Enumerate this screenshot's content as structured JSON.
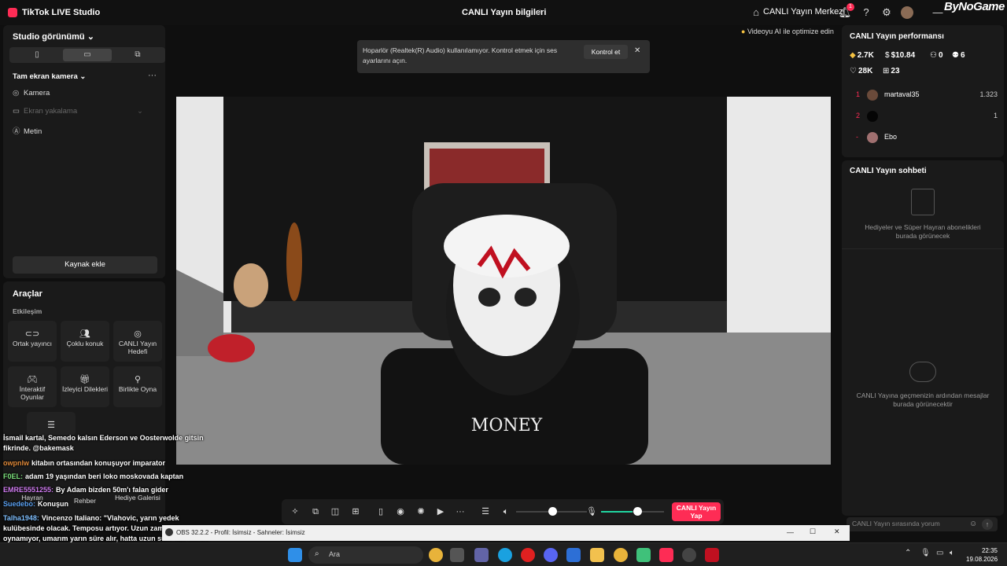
{
  "titlebar": {
    "app_title": "TikTok LIVE Studio",
    "center_title": "CANLI Yayın bilgileri",
    "live_center": "CANLI Yayın Merkezi",
    "notification_count": "1"
  },
  "watermark": "ByNoGame",
  "left_panel": {
    "studio_title": "Studio görünümü",
    "section_label": "Tam ekran kamera",
    "more": "···",
    "sources": [
      {
        "label": "Kamera",
        "icon": "camera-icon"
      },
      {
        "label": "Ekran yakalama",
        "icon": "monitor-icon"
      },
      {
        "label": "Metin",
        "icon": "text-icon"
      }
    ],
    "add_source": "Kaynak ekle"
  },
  "tools": {
    "title": "Araçlar",
    "subtitle": "Etkileşim",
    "items": [
      {
        "label": "Ortak yayıncı",
        "icon": "link-icon"
      },
      {
        "label": "Çoklu konuk",
        "icon": "users-icon"
      },
      {
        "label": "CANLI Yayın Hedefi",
        "icon": "target-icon"
      },
      {
        "label": "İnteraktif Oyunlar",
        "icon": "gamepad-icon"
      },
      {
        "label": "İzleyici Dilekleri",
        "icon": "gift-icon"
      },
      {
        "label": "Birlikte Oyna",
        "icon": "joystick-icon"
      }
    ],
    "lower_items": [
      "Hayran",
      "Rehber",
      "Hediye Galerisi"
    ]
  },
  "main": {
    "ai_optimize": "Videoyu AI ile optimize edin",
    "alert_text": "Hoparlör (Realtek(R) Audio) kullanılamıyor. Kontrol etmek için ses ayarlarını açın.",
    "alert_button": "Kontrol et",
    "go_live": "CANLI Yayın Yap"
  },
  "performance": {
    "title": "CANLI Yayın performansı",
    "stats": {
      "diamonds": "2.7K",
      "earnings": "$10.84",
      "viewers": "0",
      "followers": "6",
      "likes": "28K",
      "gifts": "23"
    },
    "ranking": [
      {
        "rank": "1",
        "name": "martaval35",
        "value": "1.323"
      },
      {
        "rank": "2",
        "name": "",
        "value": "1"
      },
      {
        "rank": "-",
        "name": "Ebo",
        "value": ""
      }
    ]
  },
  "chat_panel": {
    "title": "CANLI Yayın sohbeti",
    "gift_note": "Hediyeler ve Süper Hayran abonelikleri burada görünecek",
    "empty_note": "CANLI Yayına geçmenizin ardından mesajlar burada görünecektir",
    "input_placeholder": "CANLI Yayın sırasında yorum"
  },
  "overlay_chat": [
    {
      "user": "",
      "text": "İsmail kartal, Semedo kalsın Ederson ve Oosterwolde gitsin fikrinde. @bakemask"
    },
    {
      "user": "owpnlw",
      "text": "kitabın ortasından konuşuyor imparator"
    },
    {
      "user": "F0EL:",
      "text": "adam 19 yaşından beri loko moskovada kaptan"
    },
    {
      "user": "EMRE5551255:",
      "text": "By Adam bizden 50m'ı falan gider"
    },
    {
      "user": "Suedebo:",
      "text": "Konuşun"
    },
    {
      "user": "Talha1948:",
      "text": "Vincenzo Italiano: \"Vlahovic, yarın yedek kulübesinde olacak. Temposu artıyor. Uzun zamandır oynamıyor, umarım yarın süre alır, hatta uzun süre alır. Sonra takımla yolculuğu başlayacak. Çok değerli bir oyuncu aramıza katıl ama dikkatli olmamız gerekiyor."
    }
  ],
  "obs_bar": "OBS 32.2.2 - Profil: İsimsiz - Sahneler: İsimsiz",
  "taskbar": {
    "search_placeholder": "Ara",
    "time": "22:35",
    "date": "19.08.2026"
  }
}
